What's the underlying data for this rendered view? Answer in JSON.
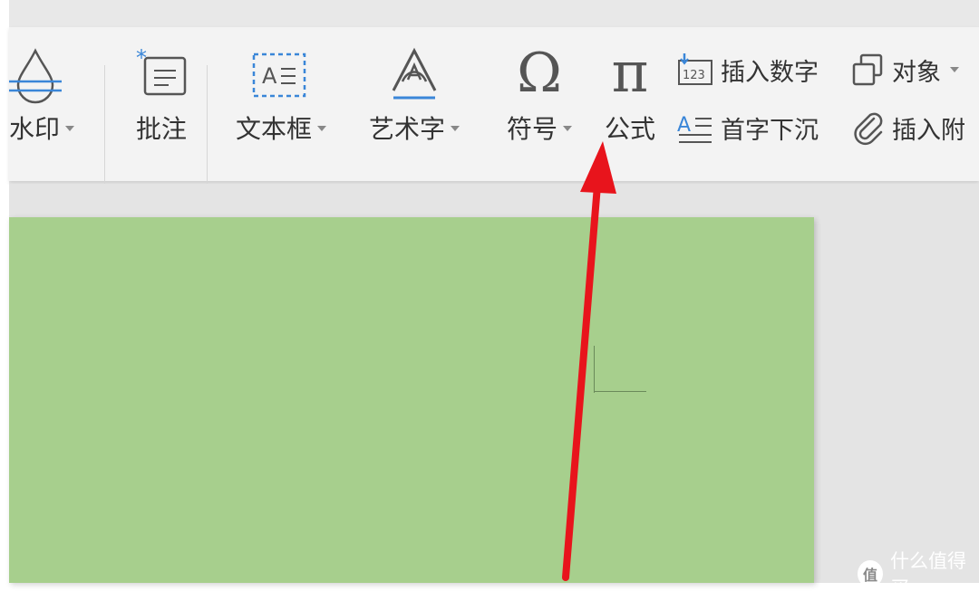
{
  "ribbon": {
    "watermark_label": "水印",
    "comment_label": "批注",
    "textbox_label": "文本框",
    "wordart_label": "艺术字",
    "symbol_label": "符号",
    "formula_label": "公式",
    "insert_number_label": "插入数字",
    "object_label": "对象",
    "drop_cap_label": "首字下沉",
    "insert_attachment_label": "插入附"
  },
  "icons": {
    "watermark": "watermark-icon",
    "comment": "comment-icon",
    "textbox": "textbox-icon",
    "wordart": "wordart-icon",
    "symbol": "omega-icon",
    "formula": "pi-icon",
    "insert_number": "insert-number-icon",
    "object": "object-icon",
    "drop_cap": "drop-cap-icon",
    "attachment": "paperclip-icon"
  },
  "icon_glyphs": {
    "symbol": "Ω",
    "formula": "π",
    "textbox_text": "A",
    "number_box": "123"
  },
  "colors": {
    "page_background": "#a7cf8d",
    "annotation_arrow": "#e8141c",
    "accent_blue": "#3a86d8"
  },
  "site_watermark": {
    "logo_text": "值",
    "text": "什么值得买"
  }
}
